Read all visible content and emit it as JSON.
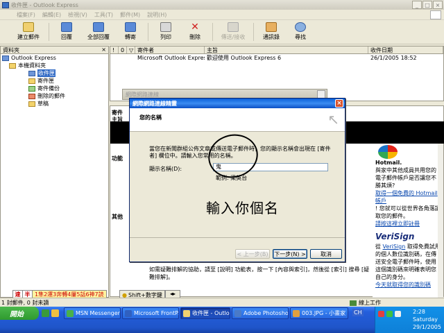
{
  "window": {
    "title": "收件匣 - Outlook Express"
  },
  "menu": [
    "檔案(F)",
    "編輯(E)",
    "檢視(V)",
    "工具(T)",
    "郵件(M)",
    "說明(H)"
  ],
  "toolbar": {
    "new_mail": "建立郵件",
    "reply": "回覆",
    "reply_all": "全部回覆",
    "forward": "轉寄",
    "print": "列印",
    "delete": "刪除",
    "send_recv": "傳送/接收",
    "addresses": "通訊錄",
    "find": "尋找"
  },
  "folders": {
    "header": "資料夾",
    "root": "Outlook Express",
    "local": "本機資料夾",
    "items": [
      "收件匣",
      "寄件匣",
      "寄件備份",
      "刪除的郵件",
      "草稿"
    ]
  },
  "messages": {
    "columns": [
      "!",
      "0",
      "▽",
      "寄件者",
      "主旨",
      "收件日期"
    ],
    "rows": [
      {
        "from": "Microsoft Outlook Expres...",
        "subject": "歡迎使用 Outlook Express 6",
        "date": "26/1/2005 18:52"
      }
    ]
  },
  "preview": {
    "side_labels": [
      "寄件",
      "主旨",
      "功能",
      "其他"
    ],
    "help_text": "如需疑難排解的協助，請至 [說明] 功能表，按一下 [內容與索引]，然後從 [索引] 搜尋 [疑難排解]。",
    "ad_msn_title": "Hotmail.",
    "ad_msn_text": "與家中其他成員共用您的電子郵件帳戶是否讓您不勝其煩?",
    "ad_msn_link": "取得一個免費的 Hotmail 帳戶",
    "ad_msn_text2": "! 您就可以從世界各角落讀取您的郵件。",
    "ad_msn_link2": "請按這裡立即註冊",
    "ad_vs_logo": "VeriSign",
    "ad_vs_prefix": "從",
    "ad_vs_linkword": "VeriSign",
    "ad_vs_text": "取得免費試用的個人數位識別碼，在傳送安全電子郵件時，使用這個識別碼來明確表明您自己的身分。",
    "ad_vs_link": "今天就取得您的識別碼"
  },
  "back_dialog": {
    "title": "網際網路連線"
  },
  "dialog": {
    "title": "網際網路連線精靈",
    "heading": "您的名稱",
    "description": "當您在新聞群組公佈文章或傳送電子郵件時，您的顯示名稱會出現在 [寄件者] 欄位中。請輸入您常用的名稱。",
    "name_label": "顯示名稱(D):",
    "name_value": "鬼",
    "example": "範例: 梁英台",
    "annotation": "輸入你個名",
    "btn_back": "< 上一步(B)",
    "btn_next": "下一步(N) >",
    "btn_cancel": "取消"
  },
  "ime": {
    "mode1": "速",
    "mode2": "半",
    "candidates": "1隼2運3奔轉4屢5話6神7読",
    "help": "Shift+數字鍵",
    "arrows": "◂▸"
  },
  "status": {
    "left": "1 封郵件, 0 封未讀",
    "right": "線上工作"
  },
  "taskbar": {
    "start": "開始",
    "tasks": [
      "MSN Messenger",
      "Microsoft FrontP...",
      "收件匣 - Outloo...",
      "Adobe Photoshop",
      "003.JPG - 小畫家"
    ],
    "lang": "CH",
    "time": "2:28",
    "day": "Saturday",
    "date": "29/1/2005"
  }
}
